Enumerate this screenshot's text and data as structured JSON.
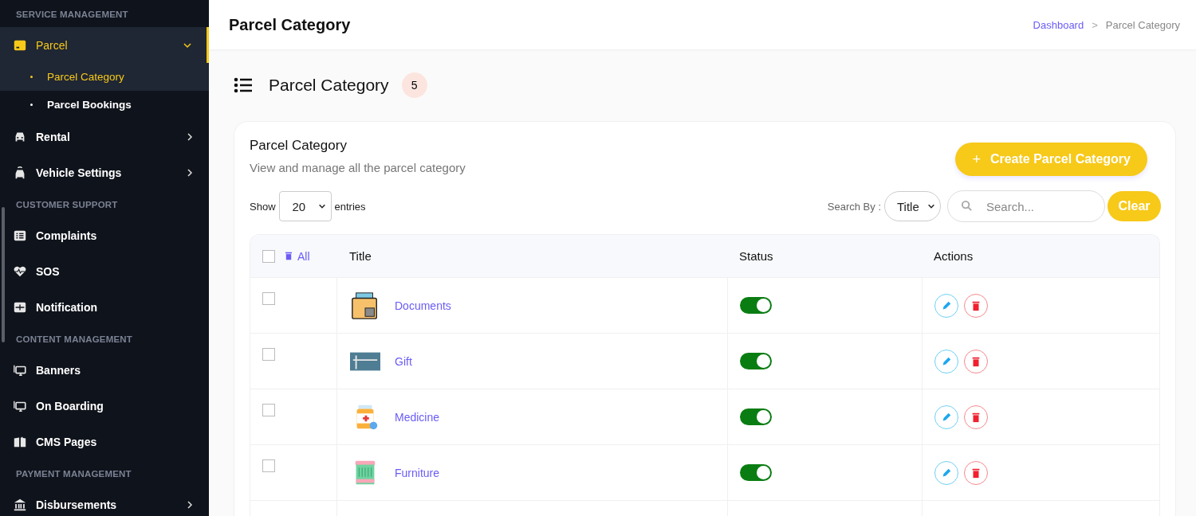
{
  "sidebar": {
    "sections": [
      {
        "heading": "SERVICE MANAGEMENT",
        "items": [
          {
            "label": "Parcel",
            "selected": true,
            "expanded": true,
            "children": [
              {
                "label": "Parcel Category",
                "selected": true
              },
              {
                "label": "Parcel Bookings",
                "selected": false
              }
            ]
          },
          {
            "label": "Rental",
            "selected": false,
            "expanded": false
          },
          {
            "label": "Vehicle Settings",
            "selected": false,
            "expanded": false
          }
        ]
      },
      {
        "heading": "CUSTOMER SUPPORT",
        "items": [
          {
            "label": "Complaints",
            "selected": false
          },
          {
            "label": "SOS",
            "selected": false
          },
          {
            "label": "Notification",
            "selected": false
          }
        ]
      },
      {
        "heading": "CONTENT MANAGEMENT",
        "items": [
          {
            "label": "Banners",
            "selected": false
          },
          {
            "label": "On Boarding",
            "selected": false
          },
          {
            "label": "CMS Pages",
            "selected": false
          }
        ]
      },
      {
        "heading": "PAYMENT MANAGEMENT",
        "items": [
          {
            "label": "Disbursements",
            "selected": false,
            "expanded": false
          }
        ]
      }
    ]
  },
  "header": {
    "title": "Parcel Category",
    "breadcrumb_separator": ">",
    "breadcrumbs": [
      {
        "label": "Dashboard",
        "selected": false
      },
      {
        "label": "Parcel Category",
        "selected": true
      }
    ]
  },
  "page": {
    "title": "Parcel Category",
    "count": "5"
  },
  "card": {
    "title": "Parcel Category",
    "subtitle": "View and manage all the parcel category",
    "create_button": "Create Parcel Category",
    "create_button_icon": "+",
    "show_label": "Show",
    "entries_value": "20",
    "entries_label": "entries",
    "search_by_label": "Search By :",
    "search_by_value": "Title",
    "search": {
      "placeholder": "Search..."
    },
    "clear_button": "Clear",
    "table": {
      "all_label": "All",
      "all_checked": false,
      "columns": [
        "Title",
        "Status",
        "Actions"
      ],
      "rows": [
        {
          "title": "Documents",
          "checked": false,
          "status_on": true
        },
        {
          "title": "Gift",
          "checked": false,
          "status_on": true
        },
        {
          "title": "Medicine",
          "checked": false,
          "status_on": true
        },
        {
          "title": "Furniture",
          "checked": false,
          "status_on": true
        }
      ]
    }
  }
}
